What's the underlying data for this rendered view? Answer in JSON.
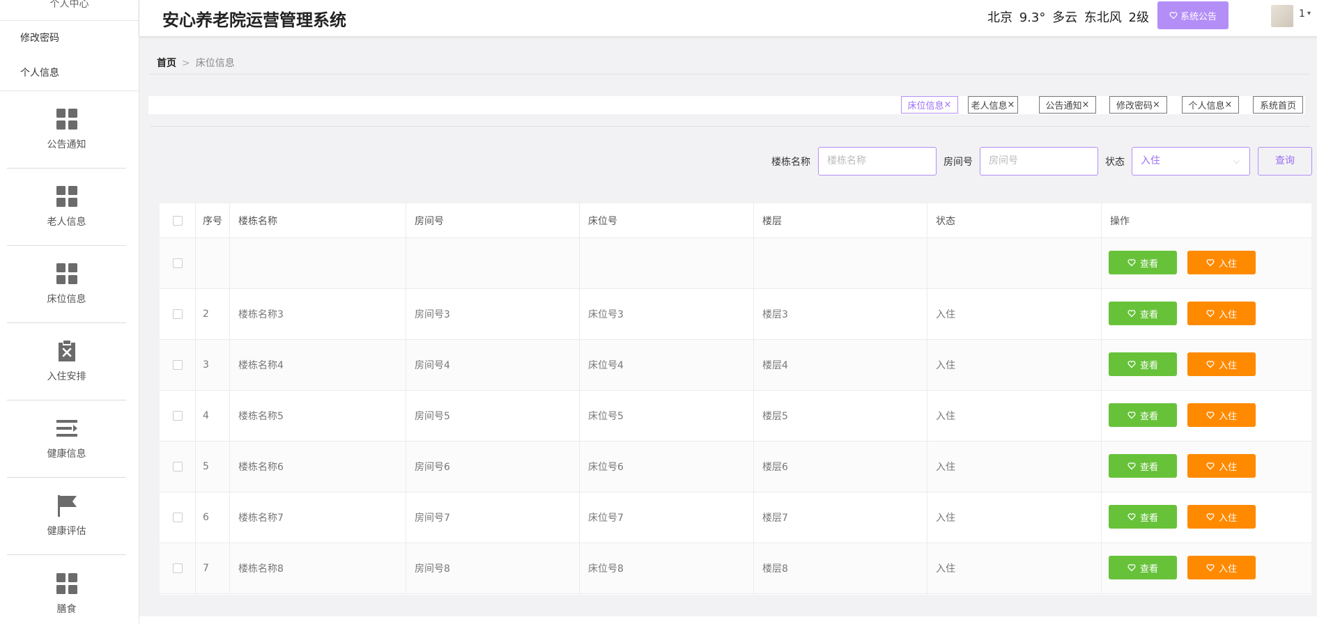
{
  "app": {
    "title": "安心养老院运营管理系统"
  },
  "header": {
    "weather": "北京 9.3° 多云 东北风 2级",
    "notice_button": "系统公告",
    "user_label": "1",
    "user_caret": "▾"
  },
  "sidebar": {
    "group_title": "个人中心",
    "sub_items": [
      {
        "label": "修改密码"
      },
      {
        "label": "个人信息"
      }
    ],
    "items": [
      {
        "label": "公告通知",
        "icon": "grid-icon"
      },
      {
        "label": "老人信息",
        "icon": "grid-icon"
      },
      {
        "label": "床位信息",
        "icon": "grid-icon"
      },
      {
        "label": "入住安排",
        "icon": "clipboard-x-icon"
      },
      {
        "label": "健康信息",
        "icon": "list-icon"
      },
      {
        "label": "健康评估",
        "icon": "flag-icon"
      },
      {
        "label": "膳食",
        "icon": "grid-icon"
      }
    ]
  },
  "breadcrumb": {
    "home": "首页",
    "separator": ">",
    "current": "床位信息"
  },
  "tags": [
    {
      "label": "床位信息",
      "close": "×"
    },
    {
      "label": "老人信息",
      "close": "×"
    },
    {
      "label": "公告通知",
      "close": "×"
    },
    {
      "label": "修改密码",
      "close": "×"
    },
    {
      "label": "个人信息",
      "close": "×"
    },
    {
      "label": "系统首页",
      "close": ""
    }
  ],
  "search": {
    "building_label": "楼栋名称",
    "building_placeholder": "楼栋名称",
    "room_label": "房间号",
    "room_placeholder": "房间号",
    "status_label": "状态",
    "status_value": "入住",
    "status_arrow": "⌵",
    "button": "查询"
  },
  "table": {
    "headers": [
      "序号",
      "楼栋名称",
      "房间号",
      "床位号",
      "楼层",
      "状态",
      "操作"
    ],
    "view_label": "查看",
    "checkin_label": "入住",
    "rows": [
      {
        "index": "",
        "building": "",
        "room": "",
        "bed": "",
        "floor": "",
        "status": ""
      },
      {
        "index": "2",
        "building": "楼栋名称3",
        "room": "房间号3",
        "bed": "床位号3",
        "floor": "楼层3",
        "status": "入住"
      },
      {
        "index": "3",
        "building": "楼栋名称4",
        "room": "房间号4",
        "bed": "床位号4",
        "floor": "楼层4",
        "status": "入住"
      },
      {
        "index": "4",
        "building": "楼栋名称5",
        "room": "房间号5",
        "bed": "床位号5",
        "floor": "楼层5",
        "status": "入住"
      },
      {
        "index": "5",
        "building": "楼栋名称6",
        "room": "房间号6",
        "bed": "床位号6",
        "floor": "楼层6",
        "status": "入住"
      },
      {
        "index": "6",
        "building": "楼栋名称7",
        "room": "房间号7",
        "bed": "床位号7",
        "floor": "楼层7",
        "status": "入住"
      },
      {
        "index": "7",
        "building": "楼栋名称8",
        "room": "房间号8",
        "bed": "床位号8",
        "floor": "楼层8",
        "status": "入住"
      }
    ]
  },
  "colors": {
    "accent": "#b48ef7",
    "view_button": "#67c23a",
    "checkin_button": "#ff8a00",
    "sidebar_icon": "#6b6b6b"
  }
}
